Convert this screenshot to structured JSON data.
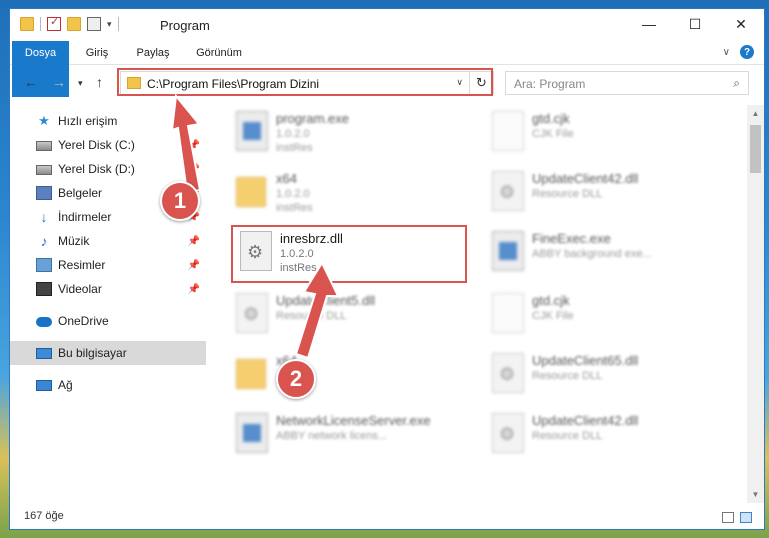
{
  "window": {
    "title": "Program",
    "controls": [
      "—",
      "☐",
      "✕"
    ]
  },
  "ribbon": {
    "tabs": [
      "Dosya",
      "Giriş",
      "Paylaş",
      "Görünüm"
    ]
  },
  "address": {
    "path": "C:\\Program Files\\Program Dizini",
    "refresh": "↻"
  },
  "search": {
    "placeholder": "Ara: Program",
    "icon": "⌕"
  },
  "nav": {
    "items": [
      {
        "label": "Hızlı erişim",
        "icon": "star-icon",
        "pinned": false
      },
      {
        "label": "Yerel Disk (C:)",
        "icon": "disk-icon",
        "pinned": true
      },
      {
        "label": "Yerel Disk (D:)",
        "icon": "disk-icon",
        "pinned": true
      },
      {
        "label": "Belgeler",
        "icon": "documents-icon",
        "pinned": true
      },
      {
        "label": "İndirmeler",
        "icon": "downloads-icon",
        "pinned": true
      },
      {
        "label": "Müzik",
        "icon": "music-icon",
        "pinned": true
      },
      {
        "label": "Resimler",
        "icon": "pictures-icon",
        "pinned": true
      },
      {
        "label": "Videolar",
        "icon": "videos-icon",
        "pinned": true
      },
      {
        "label": "OneDrive",
        "icon": "onedrive-icon",
        "pinned": false
      },
      {
        "label": "Bu bilgisayar",
        "icon": "this-pc-icon",
        "pinned": false
      },
      {
        "label": "Ağ",
        "icon": "network-icon",
        "pinned": false
      }
    ]
  },
  "files": {
    "left": [
      {
        "name": "program.exe",
        "line2": "1.0.2.0",
        "line3": "instRes",
        "kind": "exe"
      },
      {
        "name": "x64",
        "line2": "1.0.2.0",
        "line3": "instRes",
        "kind": "folder"
      },
      {
        "name": "inresbrz.dll",
        "line2": "1.0.2.0",
        "line3": "instRes",
        "kind": "dll"
      },
      {
        "name": "UpdateClient5.dll",
        "line2": "Resource DLL",
        "line3": "",
        "kind": "dll"
      },
      {
        "name": "x64",
        "line2": "",
        "line3": "",
        "kind": "folder"
      },
      {
        "name": "NetworkLicenseServer.exe",
        "line2": "ABBY network licens...",
        "line3": "",
        "kind": "exe"
      }
    ],
    "right": [
      {
        "name": "gtd.cjk",
        "line2": "CJK File",
        "kind": "generic"
      },
      {
        "name": "UpdateClient42.dll",
        "line2": "Resource DLL",
        "kind": "dll"
      },
      {
        "name": "FineExec.exe",
        "line2": "ABBY background exe...",
        "kind": "exe"
      },
      {
        "name": "gtd.cjk",
        "line2": "CJK File",
        "kind": "generic"
      },
      {
        "name": "UpdateClient65.dll",
        "line2": "Resource DLL",
        "kind": "dll"
      },
      {
        "name": "UpdateClient42.dll",
        "line2": "Resource DLL",
        "kind": "dll"
      }
    ]
  },
  "status": {
    "count": "167 öğe"
  },
  "callouts": [
    "1",
    "2"
  ],
  "colors": {
    "accent": "#1979ca",
    "annotation": "#d9534f"
  }
}
